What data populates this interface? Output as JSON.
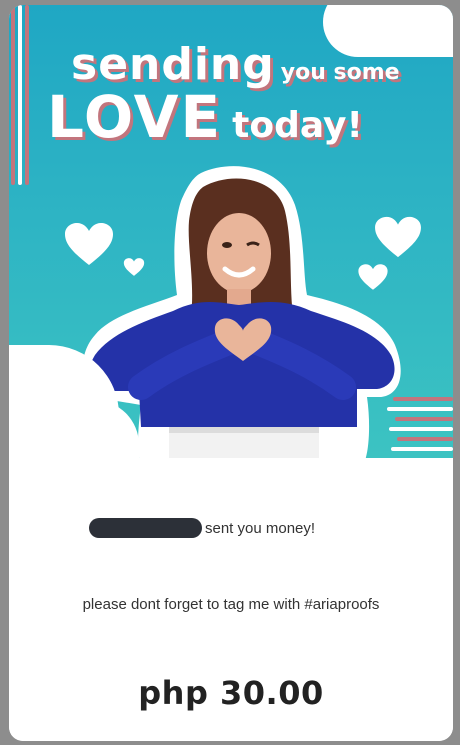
{
  "banner": {
    "headline_line1_big": "sending",
    "headline_line1_small": "you some",
    "headline_line2_big": "LOVE",
    "headline_line2_small": "today!",
    "colors": {
      "sky_top": "#1fa7c4",
      "sky_bottom": "#3cc3c2",
      "accent": "#c2757d",
      "shirt": "#2432a8"
    }
  },
  "message": {
    "sender_name_redacted": true,
    "sent_text": "sent you money!",
    "reminder_text": "please dont forget to tag me with #ariaproofs",
    "amount_text": "php 30.00"
  }
}
